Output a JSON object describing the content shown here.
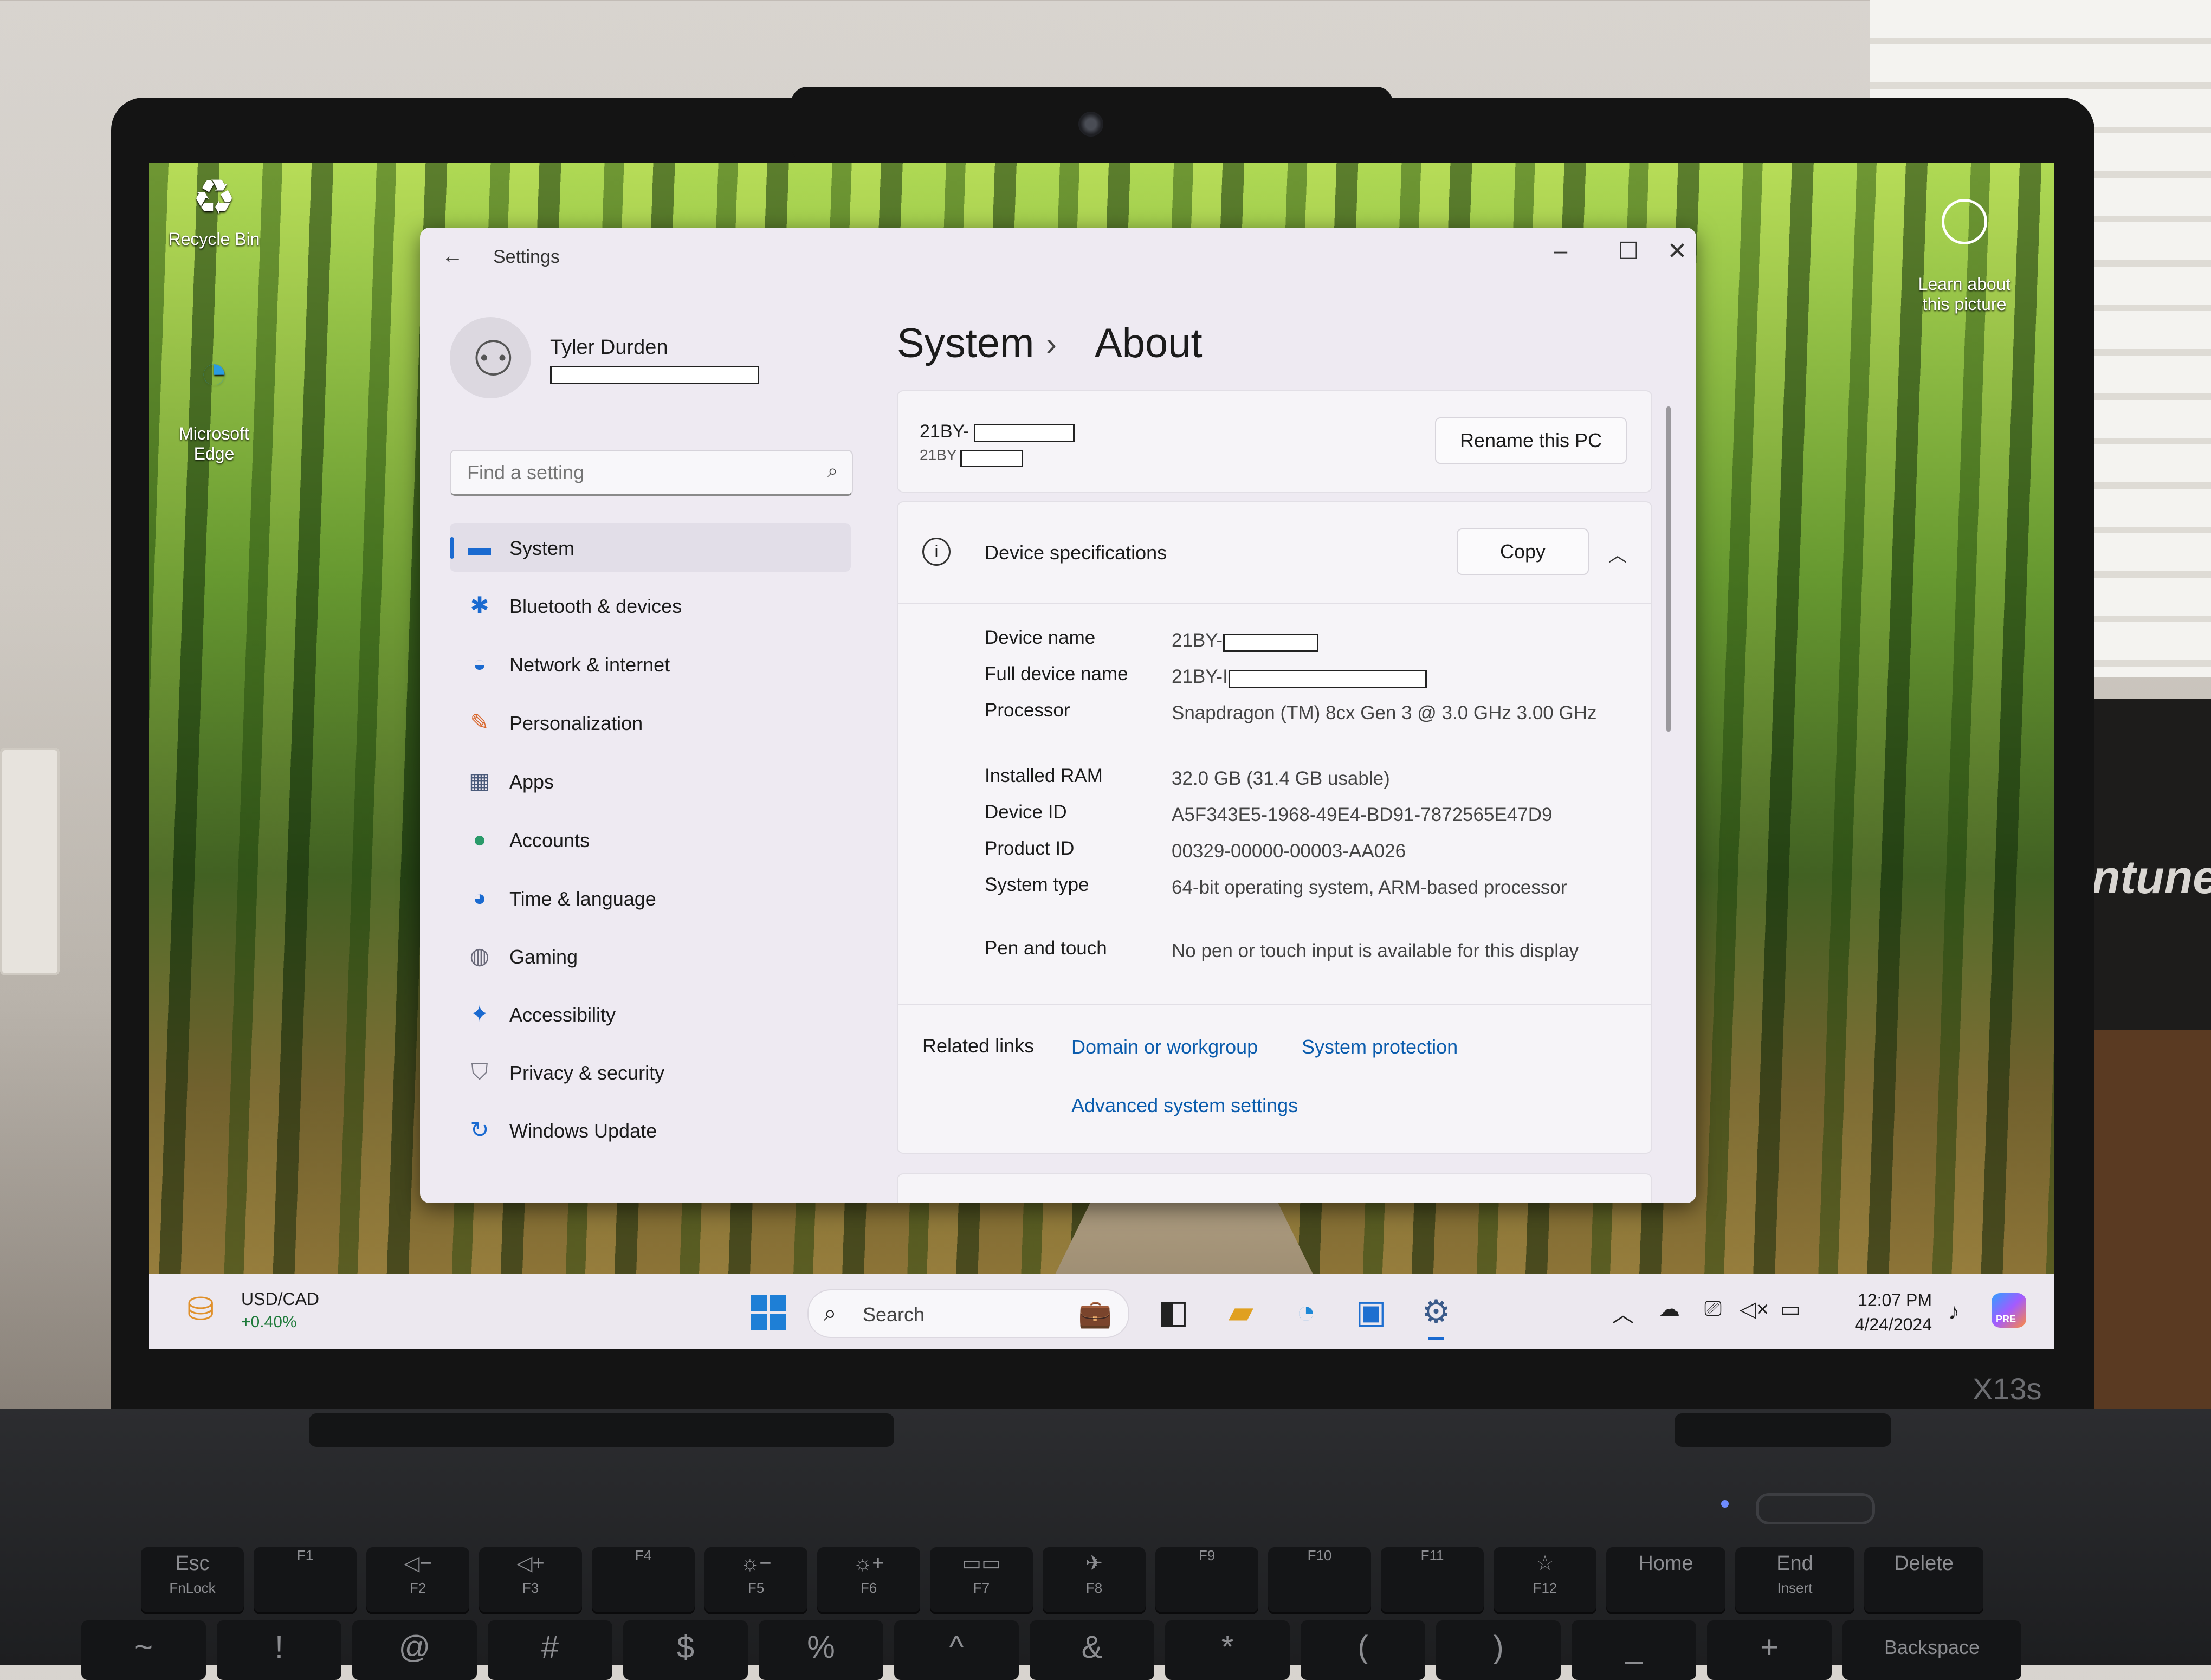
{
  "desktop": {
    "icons": [
      {
        "label": "Recycle Bin"
      },
      {
        "label": "Microsoft\nEdge"
      }
    ],
    "learn_picture": "Learn about\nthis picture"
  },
  "settings": {
    "app_title": "Settings",
    "user": {
      "name": "Tyler Durden"
    },
    "search": {
      "placeholder": "Find a setting"
    },
    "nav": [
      {
        "label": "System",
        "icon": "monitor-icon",
        "selected": true
      },
      {
        "label": "Bluetooth & devices",
        "icon": "bluetooth-icon"
      },
      {
        "label": "Network & internet",
        "icon": "wifi-icon"
      },
      {
        "label": "Personalization",
        "icon": "brush-icon"
      },
      {
        "label": "Apps",
        "icon": "apps-icon"
      },
      {
        "label": "Accounts",
        "icon": "person-icon"
      },
      {
        "label": "Time & language",
        "icon": "globe-clock-icon"
      },
      {
        "label": "Gaming",
        "icon": "gamepad-icon"
      },
      {
        "label": "Accessibility",
        "icon": "accessibility-icon"
      },
      {
        "label": "Privacy & security",
        "icon": "shield-icon"
      },
      {
        "label": "Windows Update",
        "icon": "update-icon"
      }
    ],
    "breadcrumb": {
      "parent": "System",
      "separator": "›",
      "current": "About"
    },
    "pc_card": {
      "name": "21BY-",
      "model": "21BY",
      "rename_label": "Rename this PC"
    },
    "device_specs": {
      "title": "Device specifications",
      "copy_label": "Copy",
      "rows": [
        {
          "key": "Device name",
          "value": "21BY-"
        },
        {
          "key": "Full device name",
          "value": "21BY-I                              .com"
        },
        {
          "key": "Processor",
          "value": "Snapdragon (TM) 8cx Gen 3 @ 3.0 GHz   3.00 GHz"
        },
        {
          "key": "Installed RAM",
          "value": "32.0 GB (31.4 GB usable)"
        },
        {
          "key": "Device ID",
          "value": "A5F343E5-1968-49E4-BD91-7872565E47D9"
        },
        {
          "key": "Product ID",
          "value": "00329-00000-00003-AA026"
        },
        {
          "key": "System type",
          "value": "64-bit operating system, ARM-based processor"
        },
        {
          "key": "Pen and touch",
          "value": "No pen or touch input is available for this display"
        }
      ]
    },
    "related_links": {
      "label": "Related links",
      "links": [
        "Domain or workgroup",
        "System protection",
        "Advanced system settings"
      ]
    }
  },
  "taskbar": {
    "widget": {
      "title": "USD/CAD",
      "change": "+0.40%"
    },
    "search_label": "Search",
    "apps": [
      "briefcase-icon",
      "terminal-icon",
      "file-explorer-icon",
      "edge-icon",
      "store-icon",
      "settings-gear-icon"
    ],
    "clock": {
      "time": "12:07 PM",
      "date": "4/24/2024"
    },
    "copilot_badge": "PRE"
  },
  "hardware": {
    "model": "X13s",
    "side_label": "ntune",
    "fkeys": [
      {
        "label": "Esc",
        "sub": "FnLock"
      },
      {
        "label": "",
        "sub": "F1"
      },
      {
        "label": "◁−",
        "sub": "F2"
      },
      {
        "label": "◁+",
        "sub": "F3"
      },
      {
        "label": "",
        "sub": "F4"
      },
      {
        "label": "☼−",
        "sub": "F5"
      },
      {
        "label": "☼+",
        "sub": "F6"
      },
      {
        "label": "▭▭",
        "sub": "F7"
      },
      {
        "label": "✈",
        "sub": "F8"
      },
      {
        "label": "",
        "sub": "F9"
      },
      {
        "label": "",
        "sub": "F10"
      },
      {
        "label": "",
        "sub": "F11"
      },
      {
        "label": "☆",
        "sub": "F12"
      },
      {
        "label": "Home",
        "sub": ""
      },
      {
        "label": "End",
        "sub": "Insert"
      },
      {
        "label": "Delete",
        "sub": ""
      }
    ],
    "number_row": [
      "~",
      "!",
      "@",
      "#",
      "$",
      "%",
      "^",
      "&",
      "*",
      "(",
      ")",
      "_",
      "+",
      "Backspace"
    ]
  }
}
